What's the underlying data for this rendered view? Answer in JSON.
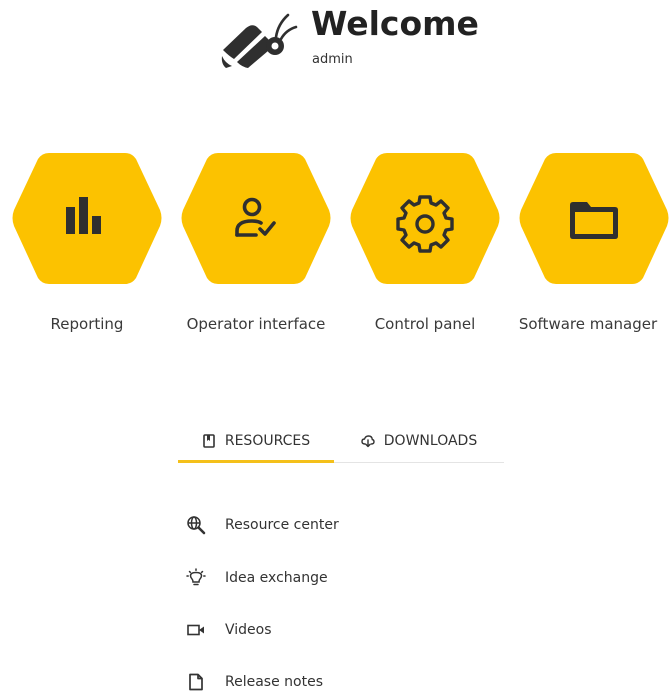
{
  "header": {
    "title": "Welcome",
    "user": "admin",
    "logo_icon": "bee-logo-icon"
  },
  "colors": {
    "accent": "#fcc200",
    "tab_underline": "#f4c01a",
    "icon_dark": "#2f2f2f",
    "text": "#3a3a3a"
  },
  "apps": [
    {
      "label": "Reporting",
      "icon": "bar-chart-icon"
    },
    {
      "label": "Operator interface",
      "icon": "user-check-icon"
    },
    {
      "label": "Control panel",
      "icon": "gear-icon"
    },
    {
      "label": "Software manager",
      "icon": "folder-icon"
    }
  ],
  "tabs": [
    {
      "label": "RESOURCES",
      "icon": "book-icon",
      "active": true
    },
    {
      "label": "DOWNLOADS",
      "icon": "cloud-download-icon",
      "active": false
    }
  ],
  "resources": [
    {
      "label": "Resource center",
      "icon": "globe-search-icon"
    },
    {
      "label": "Idea exchange",
      "icon": "lightbulb-icon"
    },
    {
      "label": "Videos",
      "icon": "video-icon"
    },
    {
      "label": "Release notes",
      "icon": "document-icon"
    }
  ]
}
